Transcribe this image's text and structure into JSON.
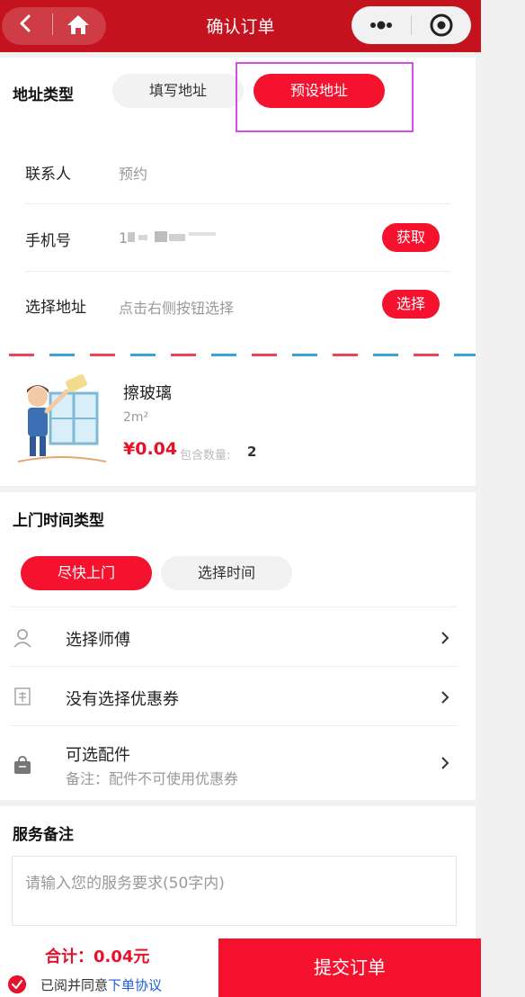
{
  "nav": {
    "title": "确认订单"
  },
  "address": {
    "type_label": "地址类型",
    "tab_fill": "填写地址",
    "tab_preset": "预设地址",
    "contact_label": "联系人",
    "contact_value": "预约",
    "phone_label": "手机号",
    "phone_value": "1",
    "phone_fetch": "获取",
    "addr_label": "选择地址",
    "addr_placeholder": "点击右侧按钮选择",
    "addr_select": "选择"
  },
  "product": {
    "name": "擦玻璃",
    "unit": "2m²",
    "price": "¥0.04",
    "qty_label": "包含数量:",
    "qty": "2"
  },
  "time": {
    "title": "上门时间类型",
    "asap": "尽快上门",
    "choose": "选择时间"
  },
  "options": {
    "master": "选择师傅",
    "coupon": "没有选择优惠券",
    "parts": "可选配件",
    "parts_note": "备注：配件不可使用优惠券"
  },
  "remark": {
    "title": "服务备注",
    "placeholder": "请输入您的服务要求(50字内)"
  },
  "footer": {
    "total": "合计：0.04元",
    "agree_prefix": "已阅并同意",
    "agree_link": "下单协议",
    "submit": "提交订单"
  },
  "colors": {
    "brand": "#c4121e",
    "accent": "#f5122e",
    "link": "#1e5fd8"
  }
}
